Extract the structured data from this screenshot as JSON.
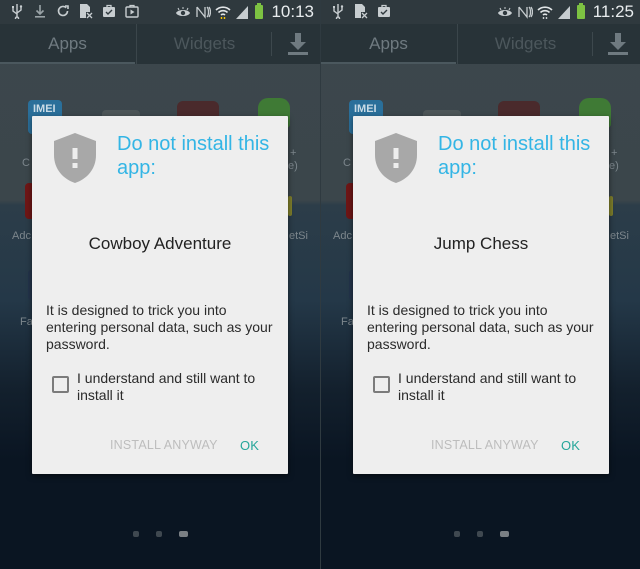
{
  "screens": [
    {
      "id": "left",
      "status_bar": {
        "left_icons": [
          "usb-icon",
          "download-icon",
          "sync-icon",
          "document-x-icon",
          "briefcase-check-icon",
          "play-store-icon"
        ],
        "right_icons": [
          "eye-icon",
          "nfc-icon",
          "wifi-icon",
          "signal-icon",
          "battery-charging-icon"
        ],
        "time": "10:13"
      },
      "tabs": {
        "apps": "Apps",
        "widgets": "Widgets"
      },
      "background_apps": {
        "imei_label": "IMEI",
        "labels": [
          "C",
          "+",
          "e)",
          "Adc",
          "F",
          "etSi",
          "Fa"
        ]
      },
      "dialog": {
        "title": "Do not install this app:",
        "app_name": "Cowboy Adventure",
        "message": "It is designed to trick you into entering personal data, such as your password.",
        "checkbox_label": "I understand and still want to install it",
        "checkbox_checked": false,
        "install_anyway_label": "INSTALL ANYWAY",
        "ok_label": "OK"
      },
      "pager": {
        "pages": 3,
        "active": 3
      }
    },
    {
      "id": "right",
      "status_bar": {
        "left_icons": [
          "usb-icon",
          "document-x-icon",
          "briefcase-check-icon"
        ],
        "right_icons": [
          "eye-icon",
          "nfc-icon",
          "wifi-icon",
          "signal-icon",
          "battery-charging-icon"
        ],
        "time": "11:25"
      },
      "tabs": {
        "apps": "Apps",
        "widgets": "Widgets"
      },
      "background_apps": {
        "imei_label": "IMEI",
        "labels": [
          "C",
          "+",
          "e)",
          "Adc",
          "F",
          "etSi",
          "Fa"
        ]
      },
      "dialog": {
        "title": "Do not install this app:",
        "app_name": "Jump Chess",
        "message": "It is designed to trick you into entering personal data, such as your password.",
        "checkbox_label": "I understand and still want to install it",
        "checkbox_checked": false,
        "install_anyway_label": "INSTALL ANYWAY",
        "ok_label": "OK"
      },
      "pager": {
        "pages": 3,
        "active": 3
      }
    }
  ],
  "colors": {
    "title_accent": "#33b5e5",
    "ok_button": "#26a69a",
    "install_anyway_disabled": "#bdbdbd",
    "dialog_bg": "#eeeeee",
    "shield": "#a8a8a8",
    "battery": "#7dc242"
  }
}
